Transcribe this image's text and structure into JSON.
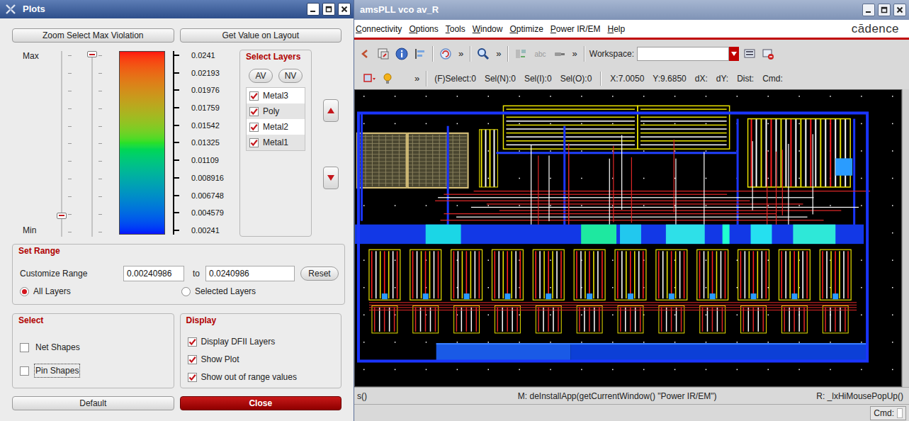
{
  "plots": {
    "title": "Plots",
    "top_buttons": [
      "Zoom Select Max Violation",
      "Get Value on Layout"
    ],
    "range_labels": {
      "max": "Max",
      "min": "Min"
    },
    "sliders": [
      {
        "level": 0.1
      },
      {
        "level": 1
      }
    ],
    "scale_ticks": [
      "0.0241",
      "0.02193",
      "0.01976",
      "0.01759",
      "0.01542",
      "0.01325",
      "0.01109",
      "0.008916",
      "0.006748",
      "0.004579",
      "0.00241"
    ],
    "layers": {
      "title": "Select Layers",
      "buttons": [
        "AV",
        "NV"
      ],
      "items": [
        {
          "label": "Metal3",
          "checked": true
        },
        {
          "label": "Poly",
          "checked": true
        },
        {
          "label": "Metal2",
          "checked": true
        },
        {
          "label": "Metal1",
          "checked": true
        }
      ]
    },
    "set_range": {
      "title": "Set Range",
      "label": "Customize Range",
      "from": "0.00240986",
      "to_label": "to",
      "to": "0.0240986",
      "reset": "Reset",
      "scope": [
        {
          "label": "All Layers",
          "selected": true
        },
        {
          "label": "Selected Layers",
          "selected": false
        }
      ]
    },
    "select": {
      "title": "Select",
      "items": [
        {
          "label": "Net Shapes",
          "checked": false,
          "focused": false
        },
        {
          "label": "Pin Shapes",
          "checked": false,
          "focused": true
        }
      ]
    },
    "display": {
      "title": "Display",
      "items": [
        {
          "label": "Display DFII Layers",
          "checked": true
        },
        {
          "label": "Show Plot",
          "checked": true
        },
        {
          "label": "Show out of range values",
          "checked": true
        }
      ]
    },
    "buttons": [
      {
        "label": "Default",
        "kind": "normal"
      },
      {
        "label": "Close",
        "kind": "accent"
      }
    ]
  },
  "layout_window": {
    "title": "amsPLL vco av_R",
    "menus": [
      "Connectivity",
      "Options",
      "Tools",
      "Window",
      "Optimize",
      "Power IR/EM",
      "Help"
    ],
    "logo": "cādence",
    "toolbar": {
      "overflow_row1": [
        "»",
        "»",
        "»"
      ],
      "stamp": "abc",
      "workspace_label": "Workspace:",
      "workspace_value": "",
      "overflow_row2": "»"
    },
    "status_fields": [
      "(F)Select:0",
      "Sel(N):0",
      "Sel(I):0",
      "Sel(O):0",
      "X:7.0050",
      "Y:9.6850",
      "dX:",
      "dY:",
      "Dist:",
      "Cmd:"
    ],
    "mouse": {
      "left": "s()",
      "middle": "M: deInstallApp(getCurrentWindow() \"Power IR/EM\")",
      "right": "R: _lxHiMousePopUp()"
    },
    "cmd_label": "Cmd:"
  }
}
